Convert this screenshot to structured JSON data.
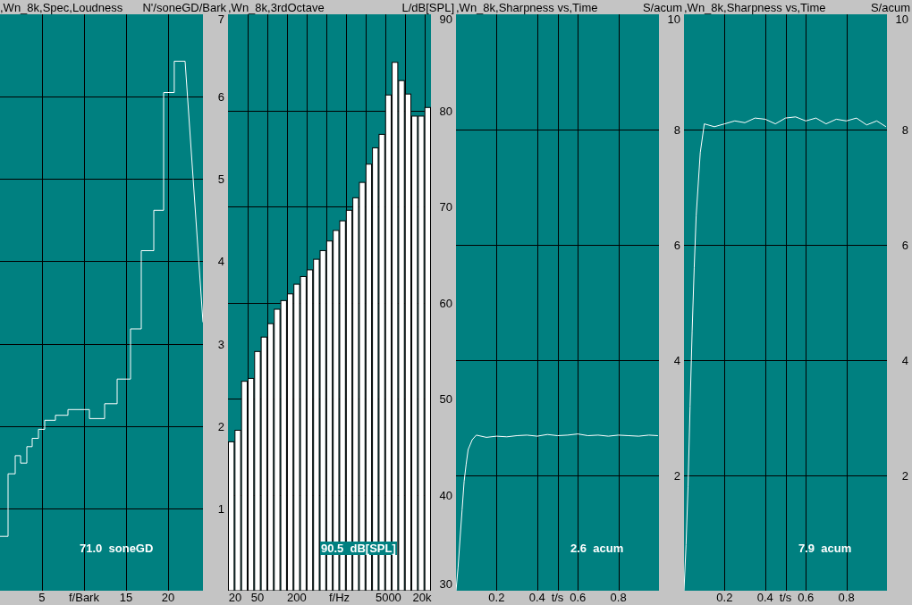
{
  "panels": [
    {
      "readout": "71.0  soneGD",
      "readout_boxed": false,
      "chart_data": {
        "type": "line",
        "title": ",Wn_8k,Spec,Loudness",
        "grid": true,
        "xlabel": "f/Bark",
        "ylabel": "N'/soneGD/Bark",
        "xlim": [
          0,
          24.15
        ],
        "ylim": [
          0,
          7
        ],
        "xticks": [
          5,
          15,
          20
        ],
        "yticks": [
          1,
          2,
          3,
          4,
          5,
          6,
          7
        ],
        "x": [
          0,
          0.96,
          0.96,
          1.81,
          1.81,
          2.45,
          2.45,
          3.19,
          3.19,
          3.83,
          3.83,
          4.57,
          4.57,
          5.32,
          5.32,
          6.6,
          6.6,
          8.09,
          8.09,
          10.64,
          10.64,
          12.45,
          12.45,
          13.94,
          13.94,
          15.53,
          15.53,
          16.81,
          16.81,
          18.3,
          18.3,
          19.47,
          19.47,
          20.74,
          20.74,
          22.02,
          24.15
        ],
        "series": [
          {
            "color": "#ffffff",
            "values": [
              0.66,
              0.66,
              1.42,
              1.42,
              1.64,
              1.64,
              1.55,
              1.55,
              1.75,
              1.75,
              1.85,
              1.85,
              1.96,
              1.96,
              2.07,
              2.07,
              2.13,
              2.13,
              2.2,
              2.2,
              2.09,
              2.09,
              2.27,
              2.27,
              2.57,
              2.57,
              3.18,
              3.18,
              4.13,
              4.13,
              4.62,
              4.62,
              6.05,
              6.05,
              6.43,
              6.43,
              3.26
            ]
          }
        ]
      }
    },
    {
      "readout": "90.5  dB[SPL]",
      "readout_boxed": true,
      "chart_data": {
        "type": "bar",
        "title": ",Wn_8k,3rdOctave",
        "grid": true,
        "xlabel": "f/Hz",
        "ylabel": "L/dB[SPL]",
        "ylim": [
          30,
          90
        ],
        "yticks": [
          30,
          40,
          50,
          60,
          70,
          80,
          90
        ],
        "categories": [
          "20",
          null,
          null,
          null,
          "50",
          null,
          null,
          null,
          null,
          null,
          "200",
          null,
          null,
          null,
          null,
          null,
          null,
          null,
          null,
          null,
          null,
          null,
          null,
          null,
          "5000",
          null,
          null,
          null,
          null,
          null,
          "20k"
        ],
        "series": [
          {
            "color": "#ffffff",
            "values": [
              45.5,
              46.7,
              51.8,
              52.1,
              54.9,
              56.4,
              57.8,
              59.3,
              60.2,
              60.9,
              61.9,
              62.7,
              63.4,
              64.5,
              65.4,
              66.4,
              67.5,
              68.5,
              69.6,
              70.9,
              72.5,
              74.4,
              76.1,
              77.5,
              81.6,
              85.0,
              83.1,
              81.7,
              79.4,
              79.4,
              80.3
            ]
          }
        ]
      }
    },
    {
      "readout": "2.6  acum",
      "readout_boxed": false,
      "chart_data": {
        "type": "line",
        "title": ",Wn_8k,Sharpness vs,Time",
        "grid": true,
        "xlabel": "t/s",
        "ylabel": "S/acum",
        "xlim": [
          0,
          1
        ],
        "ylim": [
          0,
          10
        ],
        "xticks": [
          0.2,
          0.4,
          0.6,
          0.8
        ],
        "yticks": [
          2,
          4,
          6,
          8,
          10
        ],
        "x": [
          0,
          0.01,
          0.02,
          0.03,
          0.04,
          0.05,
          0.06,
          0.08,
          0.1,
          0.15,
          0.2,
          0.25,
          0.3,
          0.35,
          0.4,
          0.45,
          0.5,
          0.55,
          0.6,
          0.65,
          0.7,
          0.75,
          0.8,
          0.85,
          0.9,
          0.95,
          0.995
        ],
        "series": [
          {
            "color": "#ffffff",
            "values": [
              0,
              0.4,
              0.9,
              1.4,
              1.9,
              2.2,
              2.45,
              2.62,
              2.7,
              2.66,
              2.68,
              2.67,
              2.69,
              2.7,
              2.68,
              2.71,
              2.69,
              2.7,
              2.72,
              2.69,
              2.7,
              2.68,
              2.7,
              2.69,
              2.68,
              2.7,
              2.69
            ]
          }
        ]
      }
    },
    {
      "readout": "7.9  acum",
      "readout_boxed": false,
      "chart_data": {
        "type": "line",
        "title": ",Wn_8k,Sharpness vs,Time",
        "grid": true,
        "xlabel": "t/s",
        "ylabel": "S/acum",
        "xlim": [
          0,
          1
        ],
        "ylim": [
          0,
          10
        ],
        "xticks": [
          0.2,
          0.4,
          0.6,
          0.8
        ],
        "yticks": [
          2,
          4,
          6,
          8,
          10
        ],
        "x": [
          0,
          0.01,
          0.02,
          0.03,
          0.04,
          0.05,
          0.06,
          0.08,
          0.1,
          0.15,
          0.2,
          0.25,
          0.3,
          0.35,
          0.4,
          0.45,
          0.5,
          0.55,
          0.6,
          0.65,
          0.7,
          0.75,
          0.8,
          0.85,
          0.9,
          0.95,
          0.995
        ],
        "series": [
          {
            "color": "#ffffff",
            "values": [
              0,
              0.8,
              1.8,
              3.2,
              4.5,
              5.6,
              6.5,
              7.6,
              8.1,
              8.05,
              8.1,
              8.15,
              8.12,
              8.2,
              8.18,
              8.1,
              8.2,
              8.22,
              8.15,
              8.2,
              8.1,
              8.18,
              8.15,
              8.2,
              8.08,
              8.15,
              8.05
            ]
          }
        ]
      }
    }
  ]
}
